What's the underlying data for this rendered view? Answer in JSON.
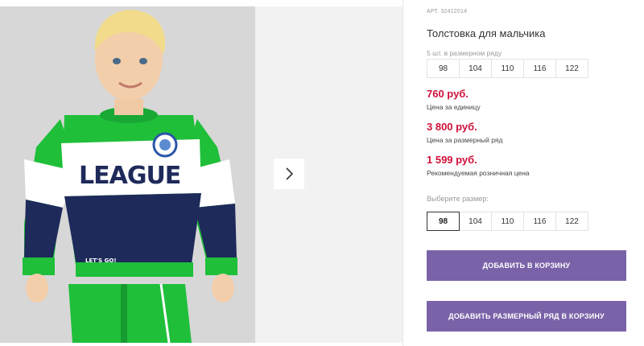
{
  "gallery": {
    "image_alt": "Boy wearing green, white and navy League sweatshirt",
    "sweatshirt_print": "LEAGUE",
    "badge_print": "LET'S GO!",
    "next_icon": "chevron-right-icon"
  },
  "product": {
    "article": "АРТ. 32412014",
    "title": "Толстовка для мальчика",
    "pack_label": "5 шт. в размерном ряду",
    "pack_sizes": [
      "98",
      "104",
      "110",
      "116",
      "122"
    ],
    "prices": [
      {
        "value": "760 руб.",
        "note": "Цена за единицу"
      },
      {
        "value": "3 800 руб.",
        "note": "Цена за размерный ряд"
      },
      {
        "value": "1 599 руб.",
        "note": "Рекомендуемая розничная цена"
      }
    ],
    "choose_label": "Выберите размер:",
    "sizes": [
      "98",
      "104",
      "110",
      "116",
      "122"
    ],
    "selected_size": "98"
  },
  "actions": {
    "add_to_cart": "ДОБАВИТЬ В КОРЗИНУ",
    "add_pack_to_cart": "ДОБАВИТЬ РАЗМЕРНЫЙ РЯД В КОРЗИНУ"
  },
  "colors": {
    "price": "#d0103a",
    "button": "#7a62a8",
    "sweatshirt_green": "#1fbf3a",
    "sweatshirt_navy": "#1e2a5a"
  }
}
